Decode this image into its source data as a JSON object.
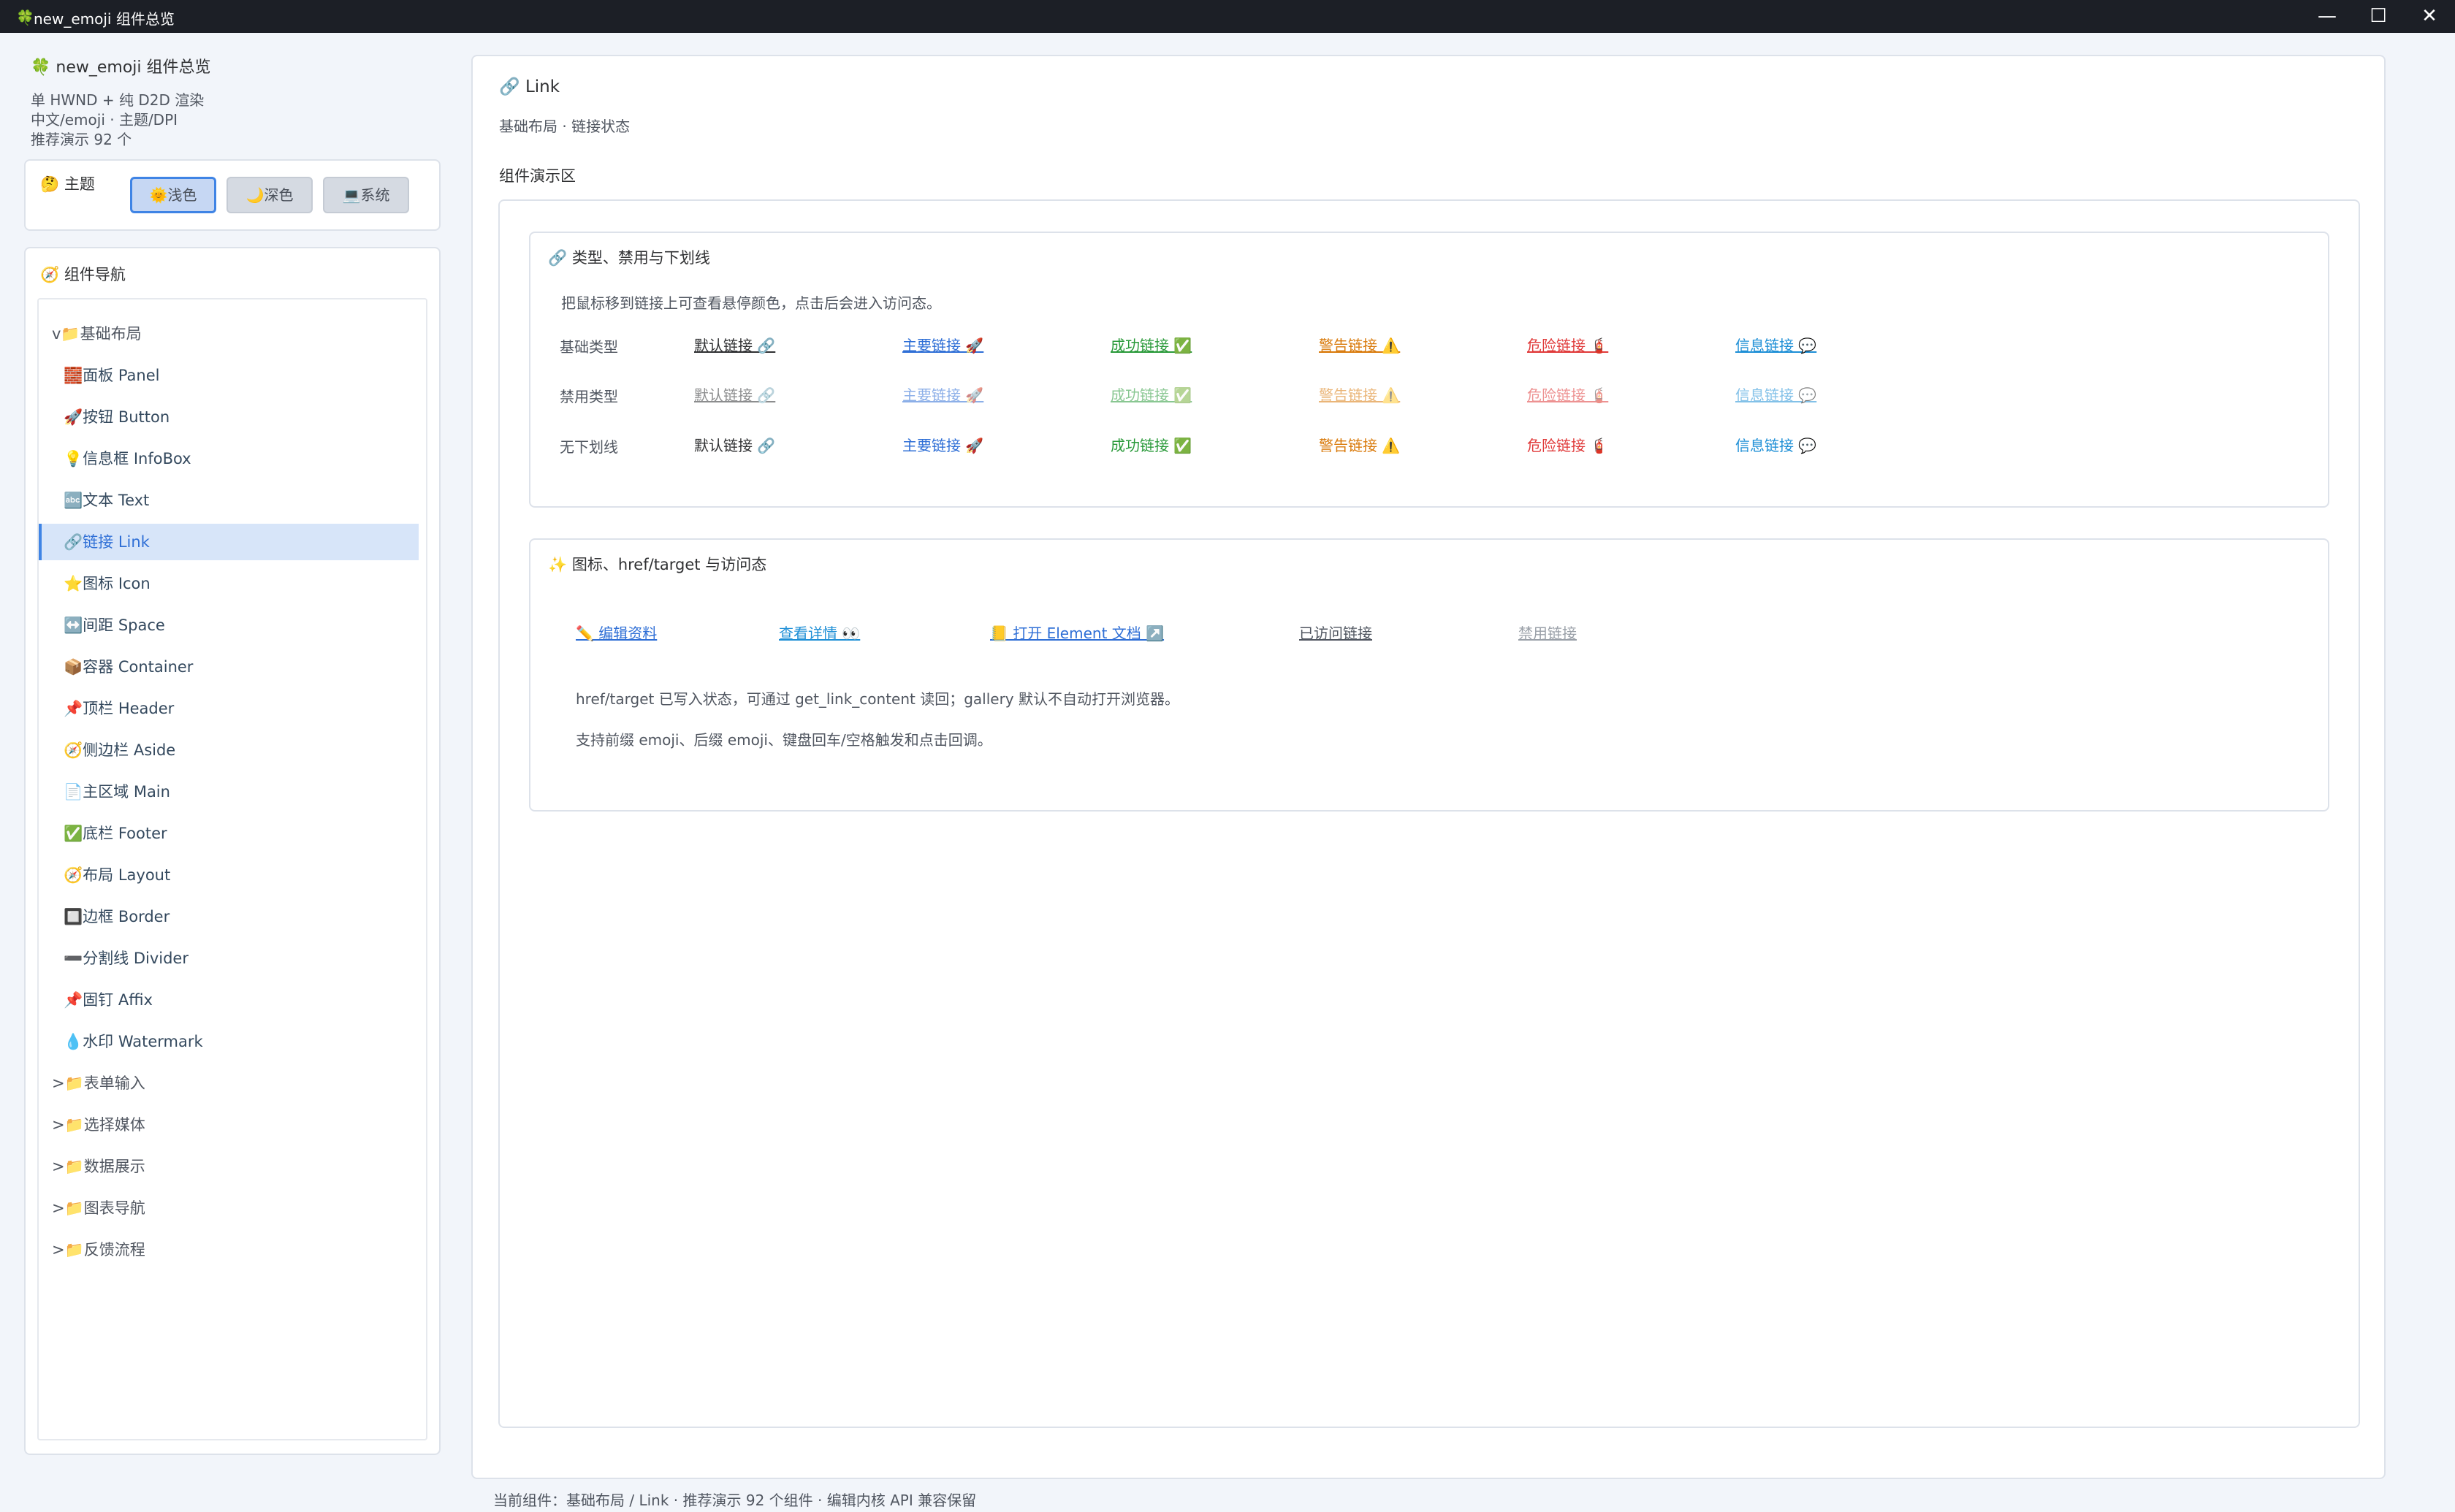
{
  "window": {
    "title": "new_emoji 组件总览",
    "icon": "🍀",
    "min_label": "—",
    "max_label": "☐",
    "close_label": "✕"
  },
  "sidebar": {
    "app_title": "🍀 new_emoji 组件总览",
    "lines": [
      "单 HWND + 纯 D2D 渲染",
      "中文/emoji · 主题/DPI",
      "推荐演示 92 个"
    ],
    "theme": {
      "label": "🤔 主题",
      "light": "🌞浅色",
      "dark": "🌙深色",
      "system": "💻系统"
    },
    "nav_title": "🧭 组件导航",
    "nav_items": [
      {
        "label": "v📁基础布局"
      },
      {
        "label": "🧱面板 Panel"
      },
      {
        "label": "🚀按钮 Button"
      },
      {
        "label": "💡信息框 InfoBox"
      },
      {
        "label": "🔤文本 Text"
      },
      {
        "label": "🔗链接 Link"
      },
      {
        "label": "⭐图标 Icon"
      },
      {
        "label": "↔️间距 Space"
      },
      {
        "label": "📦容器 Container"
      },
      {
        "label": "📌顶栏 Header"
      },
      {
        "label": "🧭侧边栏 Aside"
      },
      {
        "label": "📄主区域 Main"
      },
      {
        "label": "✅底栏 Footer"
      },
      {
        "label": "🧭布局 Layout"
      },
      {
        "label": "🔲边框 Border"
      },
      {
        "label": "➖分割线 Divider"
      },
      {
        "label": "📌固钉 Affix"
      },
      {
        "label": "💧水印 Watermark"
      },
      {
        "label": ">📁表单输入"
      },
      {
        "label": ">📁选择媒体"
      },
      {
        "label": ">📁数据展示"
      },
      {
        "label": ">📁图表导航"
      },
      {
        "label": ">📁反馈流程"
      }
    ]
  },
  "main": {
    "title": "🔗 Link",
    "subtitle": "基础布局 · 链接状态",
    "demo_label": "组件演示区",
    "card1": {
      "title": "🔗 类型、禁用与下划线",
      "desc": "把鼠标移到链接上可查看悬停颜色，点击后会进入访问态。",
      "rows": [
        {
          "label": "基础类型",
          "links": [
            "默认链接 🔗",
            "主要链接 🚀",
            "成功链接 ✅",
            "警告链接 ⚠️",
            "危险链接 🧯",
            "信息链接 💬"
          ]
        },
        {
          "label": "禁用类型",
          "links": [
            "默认链接 🔗",
            "主要链接 🚀",
            "成功链接 ✅",
            "警告链接 ⚠️",
            "危险链接 🧯",
            "信息链接 💬"
          ]
        },
        {
          "label": "无下划线",
          "links": [
            "默认链接 🔗",
            "主要链接 🚀",
            "成功链接 ✅",
            "警告链接 ⚠️",
            "危险链接 🧯",
            "信息链接 💬"
          ]
        }
      ]
    },
    "card2": {
      "title": "✨ 图标、href/target 与访问态",
      "links": [
        "✏️ 编辑资料",
        "查看详情 👀",
        "📒 打开 Element 文档 ↗️",
        "已访问链接",
        "禁用链接"
      ],
      "para1": "href/target 已写入状态，可通过 get_link_content 读回；gallery 默认不自动打开浏览器。",
      "para2": "支持前缀 emoji、后缀 emoji、键盘回车/空格触发和点击回调。"
    }
  },
  "status": "当前组件：基础布局 / Link · 推荐演示 92 个组件 · 编辑内核 API 兼容保留",
  "colors": {
    "accent": "#3f84e5",
    "default": "#303133",
    "primary": "#2f6fd6",
    "success": "#2a9a3a",
    "warning": "#d97a0b",
    "danger": "#e03a3a",
    "info": "#1e8fd6"
  }
}
